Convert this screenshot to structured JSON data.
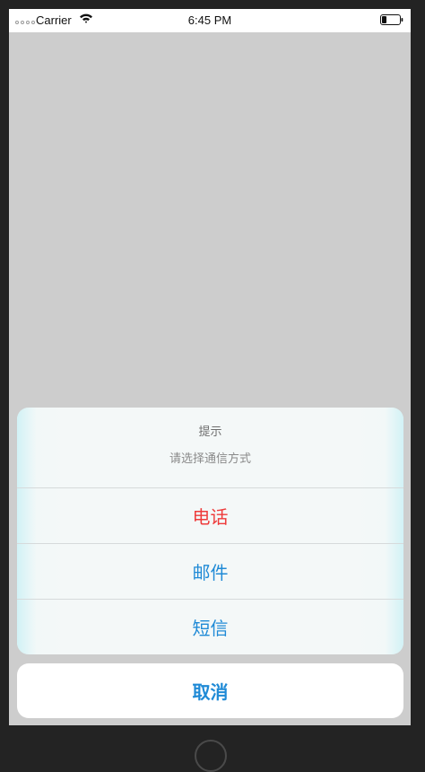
{
  "status_bar": {
    "carrier": "Carrier",
    "time": "6:45 PM",
    "signal_icon": "signal-dots-icon",
    "wifi_icon": "wifi-icon",
    "battery_icon": "battery-icon"
  },
  "action_sheet": {
    "title": "提示",
    "message": "请选择通信方式",
    "actions": [
      {
        "label": "电话",
        "style": "destructive"
      },
      {
        "label": "邮件",
        "style": "default"
      },
      {
        "label": "短信",
        "style": "default"
      }
    ],
    "cancel_label": "取消"
  },
  "colors": {
    "tint": "#1f8ad6",
    "destructive": "#ee3b3b",
    "dimmed_background": "#cdcdcd"
  }
}
